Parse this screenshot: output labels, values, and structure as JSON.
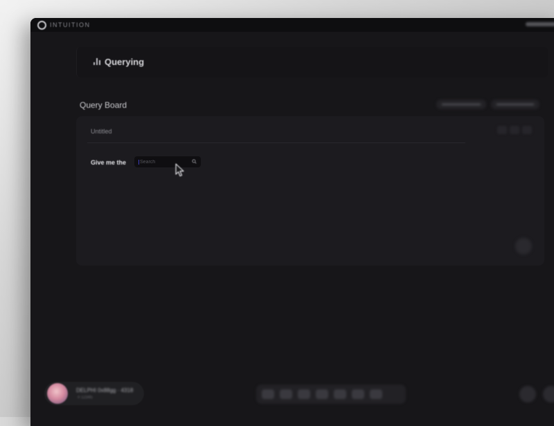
{
  "app": {
    "brand": "INTUITION"
  },
  "header": {
    "title": "Querying"
  },
  "section": {
    "title": "Query Board"
  },
  "board": {
    "name": "Untitled",
    "query_prefix": "Give me the",
    "search": {
      "placeholder": "Search",
      "value": ""
    }
  },
  "user": {
    "display_name": "DELPHI 0x88gg · 4318",
    "sub_label": "# 12345"
  },
  "icons": {
    "logo": "ring-logo-icon",
    "header": "bar-chart-icon",
    "search": "search-icon",
    "cursor": "mouse-pointer-icon"
  },
  "colors": {
    "window_bg": "#171619",
    "panel_bg": "#1c1b1f",
    "input_bg": "#0f0e11",
    "caret": "#3d3dbb",
    "avatar_accent": "#d58aa0"
  }
}
